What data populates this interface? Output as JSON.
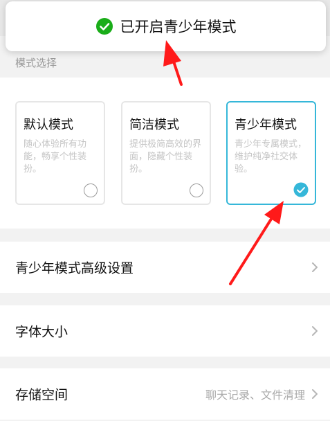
{
  "toast": {
    "text": "已开启青少年模式",
    "icon": "check-circle-icon",
    "icon_color": "#1aad19"
  },
  "mode_section": {
    "label": "模式选择",
    "modes": [
      {
        "title": "默认模式",
        "description": "随心体验所有功能，畅享个性装扮。",
        "selected": false
      },
      {
        "title": "简洁模式",
        "description": "提供极简高效的界面，隐藏个性装扮。",
        "selected": false
      },
      {
        "title": "青少年模式",
        "description": "青少年专属模式，维护纯净社交体验。",
        "selected": true
      }
    ],
    "selected_color": "#35b7d9"
  },
  "settings_rows": [
    {
      "label": "青少年模式高级设置",
      "value": ""
    },
    {
      "label": "字体大小",
      "value": ""
    },
    {
      "label": "存储空间",
      "value": "聊天记录、文件清理"
    }
  ],
  "annotation_color": "#ff1a1a"
}
